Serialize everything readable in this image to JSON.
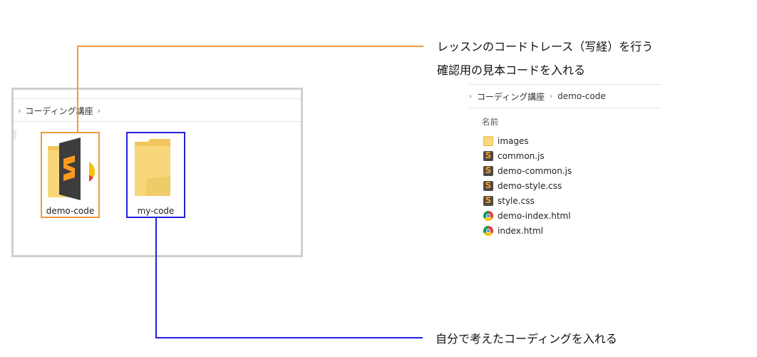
{
  "left_window": {
    "breadcrumb": "コーディング講座",
    "folders": [
      {
        "name": "demo-code",
        "highlight": "#f29a3b"
      },
      {
        "name": "my-code",
        "highlight": "#2222dd"
      }
    ]
  },
  "callouts": {
    "top_line1": "レッスンのコードトレース（写経）を行う",
    "top_line2": "確認用の見本コードを入れる",
    "bottom": "自分で考えたコーディングを入れる"
  },
  "right_panel": {
    "breadcrumb_root": "コーディング講座",
    "breadcrumb_folder": "demo-code",
    "column_header": "名前",
    "files": [
      {
        "name": "images",
        "icon": "folder-icon"
      },
      {
        "name": "common.js",
        "icon": "sublime-icon"
      },
      {
        "name": "demo-common.js",
        "icon": "sublime-icon"
      },
      {
        "name": "demo-style.css",
        "icon": "sublime-icon"
      },
      {
        "name": "style.css",
        "icon": "sublime-icon"
      },
      {
        "name": "demo-index.html",
        "icon": "chrome-icon"
      },
      {
        "name": "index.html",
        "icon": "chrome-icon"
      }
    ]
  },
  "colors": {
    "orange": "#f29a3b",
    "blue": "#2222dd",
    "folder": "#f7d77a"
  }
}
